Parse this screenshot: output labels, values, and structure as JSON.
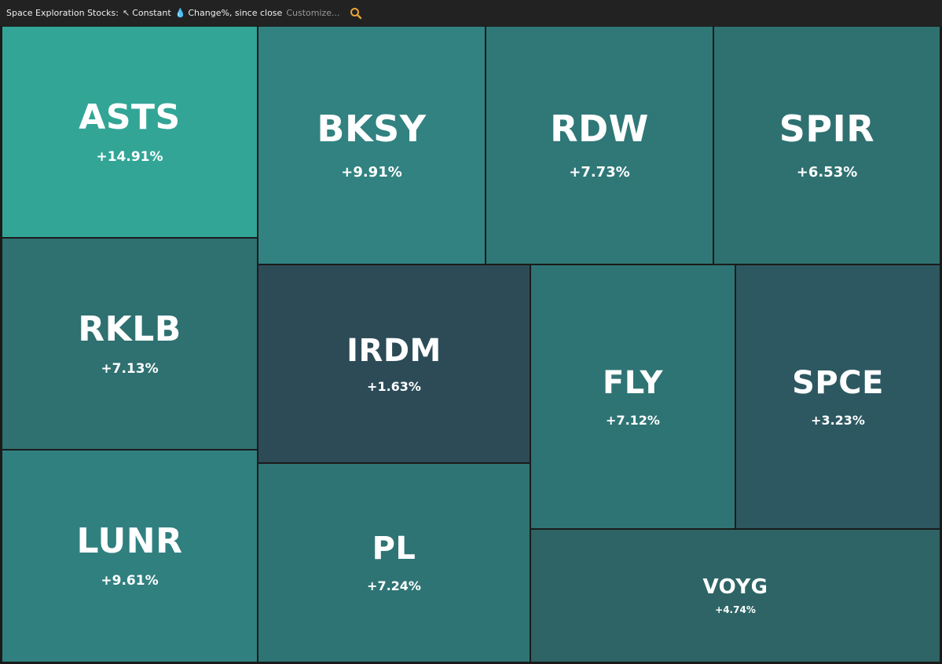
{
  "header": {
    "title": "Space Exploration Stocks:",
    "size_icon": "↖",
    "size_mode": "Constant",
    "color_icon": "💧",
    "color_mode": "Change%, since close",
    "customize": "Customize...",
    "search_icon": "search-icon"
  },
  "chart_data": {
    "type": "treemap",
    "title": "Space Exploration Stocks:",
    "size_metric": "Constant",
    "color_metric": "Change%, since close",
    "tiles": [
      {
        "symbol": "ASTS",
        "change": "+14.91%",
        "value": 14.91,
        "color": "#32a597"
      },
      {
        "symbol": "BKSY",
        "change": "+9.91%",
        "value": 9.91,
        "color": "#318281"
      },
      {
        "symbol": "RDW",
        "change": "+7.73%",
        "value": 7.73,
        "color": "#2f7877"
      },
      {
        "symbol": "SPIR",
        "change": "+6.53%",
        "value": 6.53,
        "color": "#2f7070"
      },
      {
        "symbol": "RKLB",
        "change": "+7.13%",
        "value": 7.13,
        "color": "#2f7070"
      },
      {
        "symbol": "IRDM",
        "change": "+1.63%",
        "value": 1.63,
        "color": "#2c4b57"
      },
      {
        "symbol": "FLY",
        "change": "+7.12%",
        "value": 7.12,
        "color": "#2f7474"
      },
      {
        "symbol": "SPCE",
        "change": "+3.23%",
        "value": 3.23,
        "color": "#2d5861"
      },
      {
        "symbol": "LUNR",
        "change": "+9.61%",
        "value": 9.61,
        "color": "#318080"
      },
      {
        "symbol": "PL",
        "change": "+7.24%",
        "value": 7.24,
        "color": "#2f7474"
      },
      {
        "symbol": "VOYG",
        "change": "+4.74%",
        "value": 4.74,
        "color": "#2e6466"
      }
    ]
  }
}
